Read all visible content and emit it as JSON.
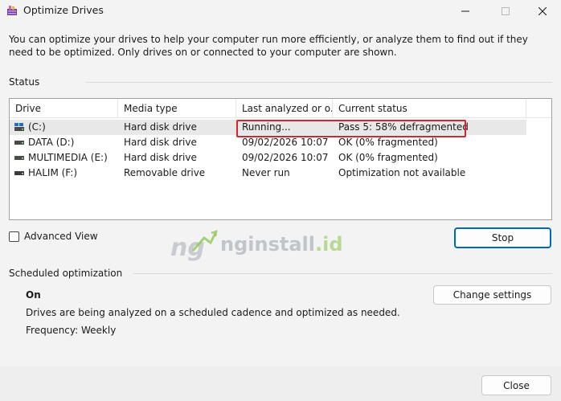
{
  "window": {
    "title": "Optimize Drives",
    "minimize_icon": "minimize-icon",
    "maximize_icon": "maximize-icon",
    "close_icon": "close-icon"
  },
  "intro": "You can optimize your drives to help your computer run more efficiently, or analyze them to find out if they need to be optimized. Only drives on or connected to your computer are shown.",
  "status": {
    "label": "Status",
    "columns": [
      "Drive",
      "Media type",
      "Last analyzed or o...",
      "Current status"
    ],
    "drives": [
      {
        "name": "(C:)",
        "icon": "system-drive-icon",
        "media": "Hard disk drive",
        "last": "Running...",
        "status": "Pass 5: 58% defragmented"
      },
      {
        "name": "DATA (D:)",
        "icon": "hard-drive-icon",
        "media": "Hard disk drive",
        "last": "09/02/2026 10:07",
        "status": "OK (0% fragmented)"
      },
      {
        "name": "MULTIMEDIA (E:)",
        "icon": "hard-drive-icon",
        "media": "Hard disk drive",
        "last": "09/02/2026 10:07",
        "status": "OK (0% fragmented)"
      },
      {
        "name": "HALIM (F:)",
        "icon": "removable-drive-icon",
        "media": "Removable drive",
        "last": "Never run",
        "status": "Optimization not available"
      }
    ],
    "highlight_color": "#d9262e"
  },
  "advanced_view": {
    "label": "Advanced View",
    "checked": false
  },
  "stop_button": "Stop",
  "watermark": {
    "prefix": "nginstall",
    "suffix": ".id"
  },
  "scheduled": {
    "label": "Scheduled optimization",
    "state": "On",
    "description": "Drives are being analyzed on a scheduled cadence and optimized as needed.",
    "frequency": "Frequency: Weekly",
    "change_button": "Change settings"
  },
  "close_button": "Close",
  "colors": {
    "accent": "#0067c0",
    "background": "#f3f3f3"
  }
}
